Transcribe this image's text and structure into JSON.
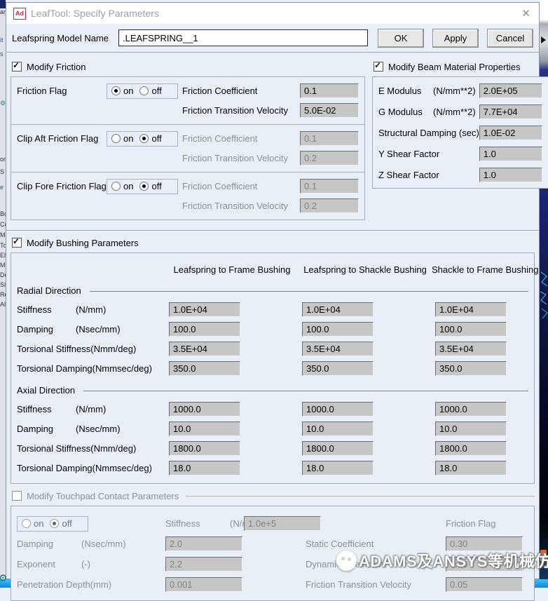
{
  "window": {
    "title": "LeafTool: Specify Parameters",
    "icon_text": "Ad",
    "close_glyph": "✕"
  },
  "header": {
    "model_name_label": "Leafspring Model Name",
    "model_name_value": ".LEAFSPRING__1",
    "ok_label": "OK",
    "apply_label": "Apply",
    "cancel_label": "Cancel"
  },
  "radio": {
    "on": "on",
    "off": "off"
  },
  "friction": {
    "checkbox_label": "Modify Friction",
    "checked": true,
    "rows": [
      {
        "flag_label": "Friction Flag",
        "selected": "on",
        "coeff_label": "Friction Coefficient",
        "coeff_value": "0.1",
        "vel_label": "Friction Transition Velocity",
        "vel_value": "5.0E-02"
      },
      {
        "flag_label": "Clip Aft Friction Flag",
        "selected": "off",
        "coeff_label": "Friction Coefficient",
        "coeff_value": "0.1",
        "vel_label": "Friction Transition Velocity",
        "vel_value": "0.2"
      },
      {
        "flag_label": "Clip Fore Friction Flag",
        "selected": "off",
        "coeff_label": "Friction Coefficient",
        "coeff_value": "0.1",
        "vel_label": "Friction Transition Velocity",
        "vel_value": "0.2"
      }
    ]
  },
  "beam": {
    "checkbox_label": "Modify Beam Material Properties",
    "checked": true,
    "rows": [
      {
        "label": "E Modulus",
        "unit": "(N/mm**2)",
        "value": "2.0E+05"
      },
      {
        "label": "G Modulus",
        "unit": "(N/mm**2)",
        "value": "7.7E+04"
      },
      {
        "label": "Structural Damping (sec)",
        "unit": "",
        "value": "1.0E-02"
      },
      {
        "label": "Y Shear Factor",
        "unit": "",
        "value": "1.0"
      },
      {
        "label": "Z Shear Factor",
        "unit": "",
        "value": "1.0"
      }
    ]
  },
  "bushing": {
    "checkbox_label": "Modify Bushing Parameters",
    "checked": true,
    "columns": [
      "Leafspring to Frame Bushing",
      "Leafspring to Shackle Bushing",
      "Shackle to Frame Bushing"
    ],
    "radial": {
      "title": "Radial Direction",
      "rows": [
        {
          "label": "Stiffness",
          "unit": "(N/mm)",
          "values": [
            "1.0E+04",
            "1.0E+04",
            "1.0E+04"
          ]
        },
        {
          "label": "Damping",
          "unit": "(Nsec/mm)",
          "values": [
            "100.0",
            "100.0",
            "100.0"
          ]
        },
        {
          "label": "Torsional Stiffness",
          "unit": "(Nmm/deg)",
          "values": [
            "3.5E+04",
            "3.5E+04",
            "3.5E+04"
          ]
        },
        {
          "label": "Torsional Damping",
          "unit": "(Nmmsec/deg)",
          "values": [
            "350.0",
            "350.0",
            "350.0"
          ]
        }
      ]
    },
    "axial": {
      "title": "Axial Direction",
      "rows": [
        {
          "label": "Stiffness",
          "unit": "(N/mm)",
          "values": [
            "1000.0",
            "1000.0",
            "1000.0"
          ]
        },
        {
          "label": "Damping",
          "unit": "(Nsec/mm)",
          "values": [
            "10.0",
            "10.0",
            "10.0"
          ]
        },
        {
          "label": "Torsional Stiffness",
          "unit": "(Nmm/deg)",
          "values": [
            "1800.0",
            "1800.0",
            "1800.0"
          ]
        },
        {
          "label": "Torsional Damping",
          "unit": "(Nmmsec/deg)",
          "values": [
            "18.0",
            "18.0",
            "18.0"
          ]
        }
      ]
    }
  },
  "touchpad": {
    "checkbox_label": "Modify Touchpad Contact Parameters",
    "checked": false,
    "left_rows": [
      {
        "label": "Stiffness",
        "unit": "(N/mm)",
        "value": "1.0e+5"
      },
      {
        "label": "Damping",
        "unit": "(Nsec/mm)",
        "value": "2.0"
      },
      {
        "label": "Exponent",
        "unit": "(-)",
        "value": "2.2"
      },
      {
        "label": "Penetration Depth",
        "unit": "(mm)",
        "value": "0.001"
      }
    ],
    "right_rows": [
      {
        "label": "Friction Flag",
        "selected": "off"
      },
      {
        "label": "Static Coefficient",
        "value": "0.30"
      },
      {
        "label": "Dynamic Coefficient",
        "value": "0.10"
      },
      {
        "label": "Friction Transition Velocity",
        "value": "0.05"
      }
    ]
  },
  "watermark": {
    "text": "ADAMS及ANSYS等机械仿真"
  },
  "left_strip": {
    "fragments": [
      "an",
      "it",
      "s",
      "⚙",
      "or",
      "S",
      "e",
      "Bc",
      "Cc",
      "Mc",
      "To",
      "El",
      "Me",
      "De",
      "Si",
      "Re",
      "All"
    ]
  },
  "colors": {
    "dialog_bg": "#e9eff7",
    "field_bg": "#c6c6c6",
    "title_text": "#9aa1a9",
    "bottom_bar_blue": "#0d86dc",
    "app_icon_red": "#c2293a"
  }
}
